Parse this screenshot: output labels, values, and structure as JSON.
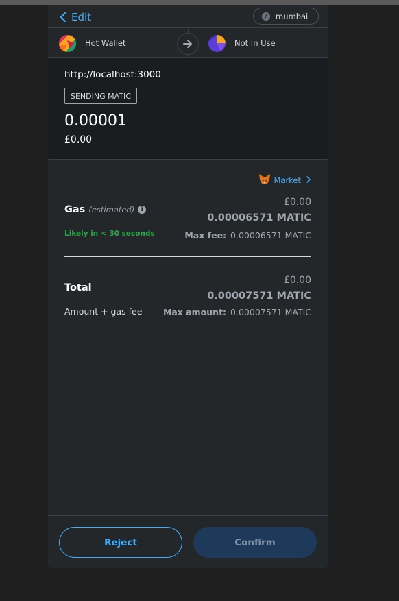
{
  "header": {
    "edit_label": "Edit",
    "network": "mumbai",
    "network_help_glyph": "?"
  },
  "accounts": {
    "from_name": "Hot Wallet",
    "to_name": "Not In Use"
  },
  "summary": {
    "origin": "http://localhost:3000",
    "tag": "SENDING MATIC",
    "amount": "0.00001",
    "fiat": "£0.00"
  },
  "gas": {
    "market_label": "Market",
    "title": "Gas",
    "estimated": "(estimated)",
    "info_glyph": "i",
    "likely": "Likely in < 30 seconds",
    "fiat": "£0.00",
    "native": "0.00006571 MATIC",
    "max_label": "Max fee:",
    "max_value": "0.00006571 MATIC"
  },
  "total": {
    "title": "Total",
    "subtitle": "Amount + gas fee",
    "fiat": "£0.00",
    "native": "0.00007571 MATIC",
    "max_label": "Max amount:",
    "max_value": "0.00007571 MATIC"
  },
  "footer": {
    "reject_label": "Reject",
    "confirm_label": "Confirm"
  },
  "colors": {
    "accent": "#43aefc",
    "success": "#28a745",
    "background": "#24272a",
    "summary_bg": "#1a1d20"
  }
}
